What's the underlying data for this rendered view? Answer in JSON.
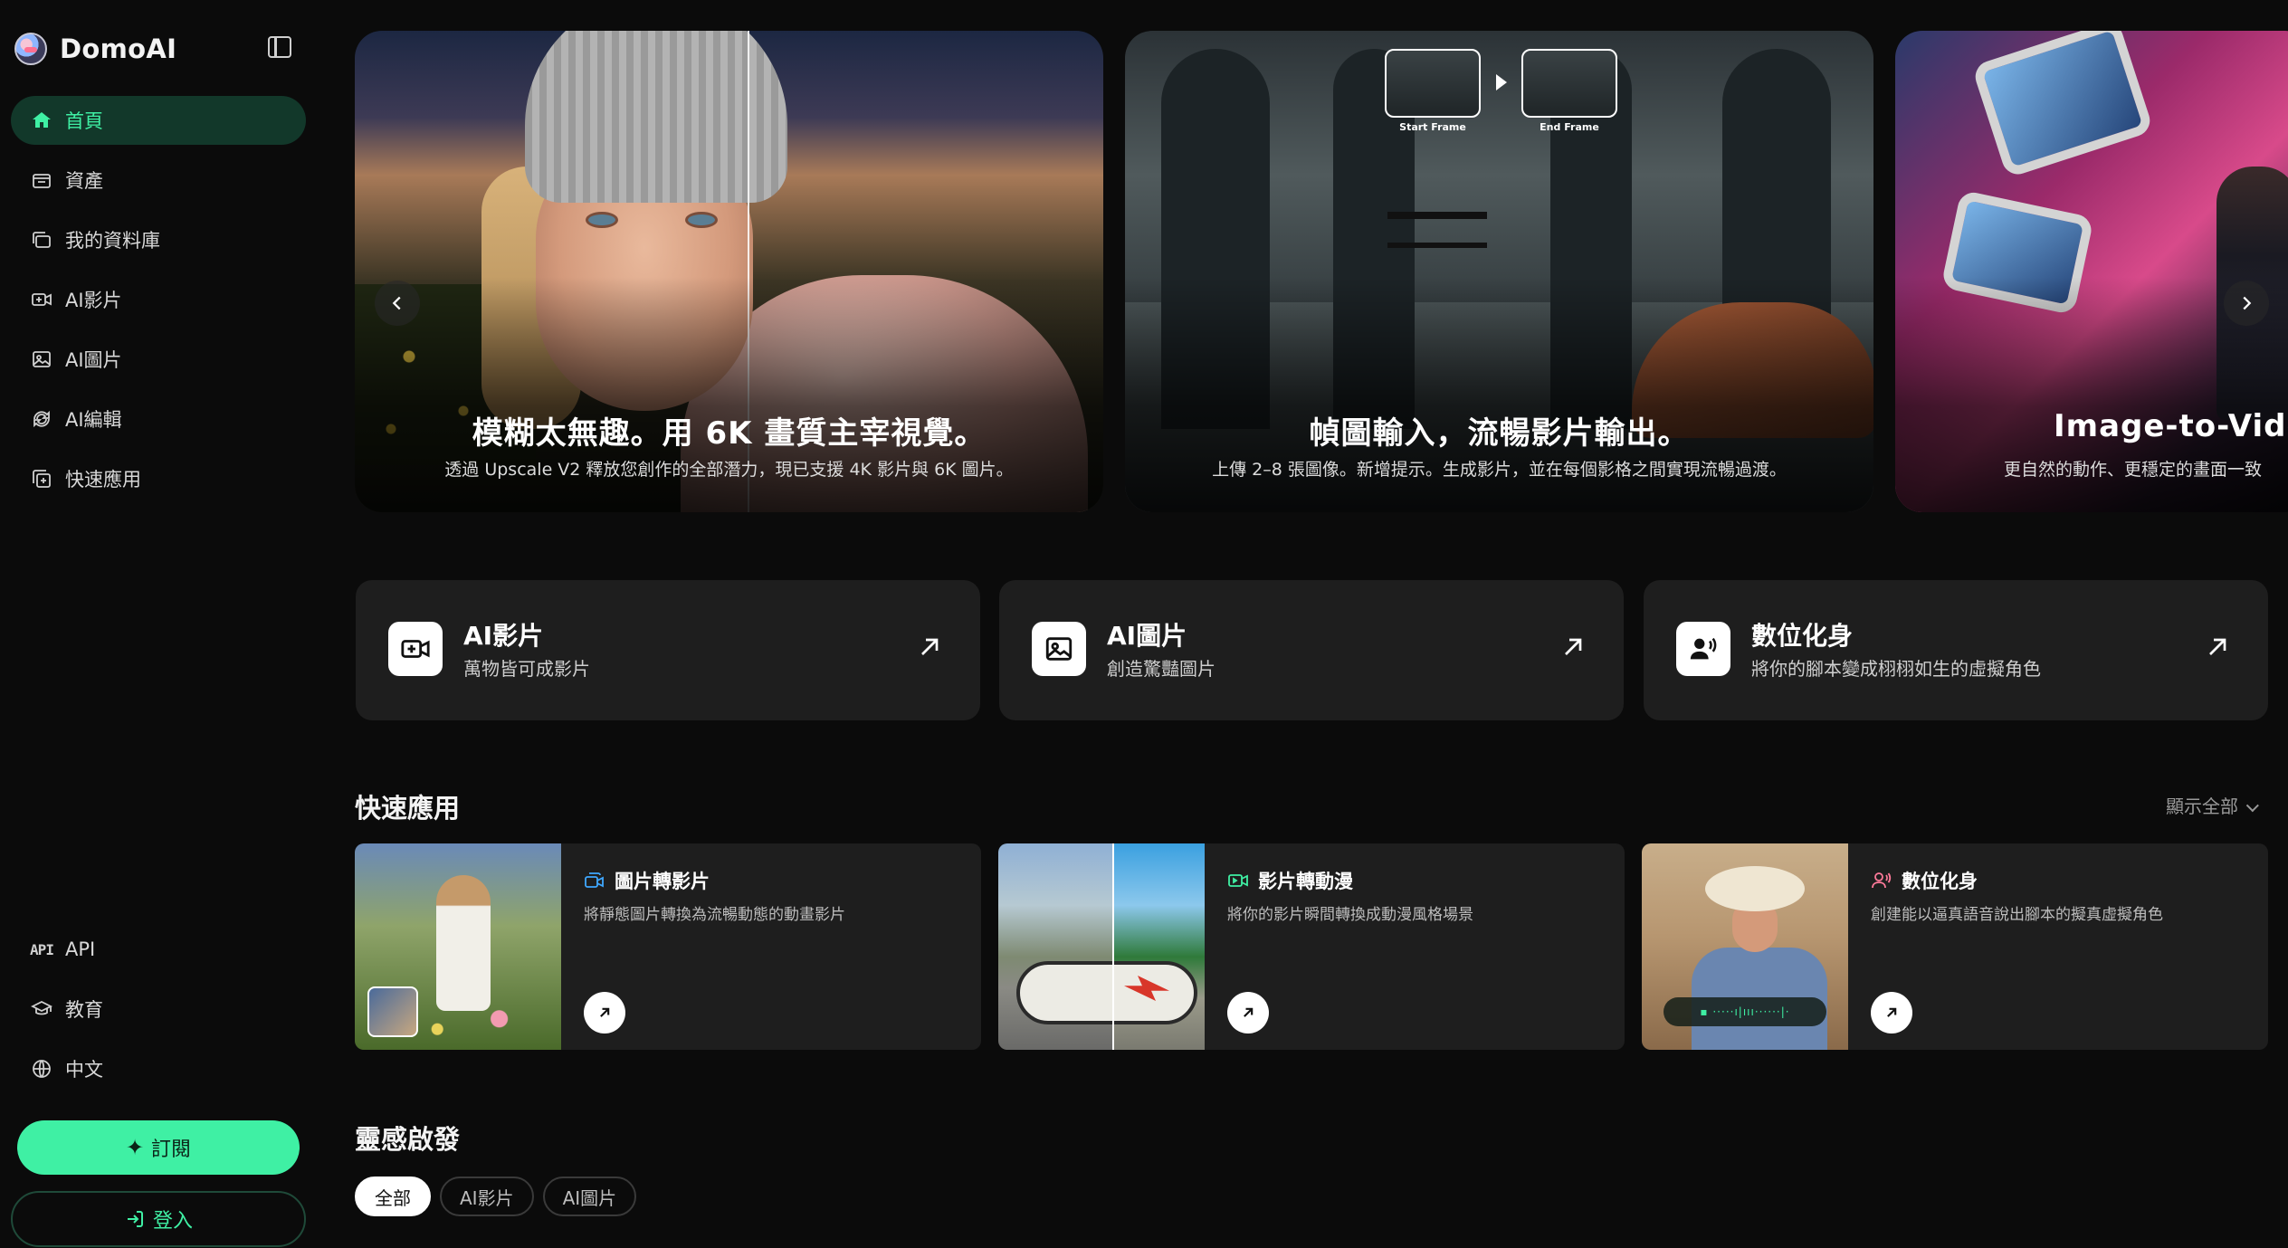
{
  "brand": {
    "name": "DomoAI"
  },
  "nav": {
    "items": [
      {
        "label": "首頁",
        "icon": "home-icon",
        "active": true
      },
      {
        "label": "資產",
        "icon": "assets-icon",
        "active": false
      },
      {
        "label": "我的資料庫",
        "icon": "library-icon",
        "active": false
      },
      {
        "label": "AI影片",
        "icon": "video-icon",
        "active": false
      },
      {
        "label": "AI圖片",
        "icon": "image-icon",
        "active": false
      },
      {
        "label": "AI編輯",
        "icon": "edit-icon",
        "active": false
      },
      {
        "label": "快速應用",
        "icon": "quick-apps-icon",
        "active": false
      }
    ],
    "bottom": [
      {
        "label": "API",
        "icon_text": "API"
      },
      {
        "label": "教育",
        "icon": "education-icon"
      },
      {
        "label": "中文",
        "icon": "globe-icon"
      }
    ],
    "subscribe_label": "訂閱",
    "login_label": "登入"
  },
  "banners": [
    {
      "title": "模糊太無趣。用 6K 畫質主宰視覺。",
      "subtitle": "透過 Upscale V2 釋放您創作的全部潛力，現已支援 4K 影片與 6K 圖片。"
    },
    {
      "title": "幀圖輸入，流暢影片輸出。",
      "subtitle": "上傳 2–8 張圖像。新增提示。生成影片，並在每個影格之間實現流暢過渡。",
      "start_frame_label": "Start Frame",
      "end_frame_label": "End Frame"
    },
    {
      "title": "Image-to-Video",
      "subtitle": "更自然的動作、更穩定的畫面一致"
    }
  ],
  "features": [
    {
      "title": "AI影片",
      "desc": "萬物皆可成影片",
      "icon": "video-plus-icon"
    },
    {
      "title": "AI圖片",
      "desc": "創造驚豔圖片",
      "icon": "image-icon"
    },
    {
      "title": "數位化身",
      "desc": "將你的腳本變成栩栩如生的虛擬角色",
      "icon": "avatar-speaking-icon"
    }
  ],
  "quick_apps": {
    "title": "快速應用",
    "show_all": "顯示全部",
    "cards": [
      {
        "title": "圖片轉影片",
        "desc": "將靜態圖片轉換為流暢動態的動畫影片",
        "icon": "image-to-video-icon",
        "accent": "#3fa8ff"
      },
      {
        "title": "影片轉動漫",
        "desc": "將你的影片瞬間轉換成動漫風格場景",
        "icon": "video-to-anime-icon",
        "accent": "#3ff0a4"
      },
      {
        "title": "數位化身",
        "desc": "創建能以逼真語音說出腳本的擬真虛擬角色",
        "icon": "avatar-icon",
        "accent": "#ff7a9a"
      }
    ]
  },
  "inspiration": {
    "title": "靈感啟發",
    "chips": [
      {
        "label": "全部",
        "active": true
      },
      {
        "label": "AI影片",
        "active": false
      },
      {
        "label": "AI圖片",
        "active": false
      }
    ]
  },
  "colors": {
    "accent": "#3ff0a4",
    "active_nav_bg": "#12382a",
    "card_bg": "#1e1e1e",
    "page_bg": "#0b0b0b"
  }
}
